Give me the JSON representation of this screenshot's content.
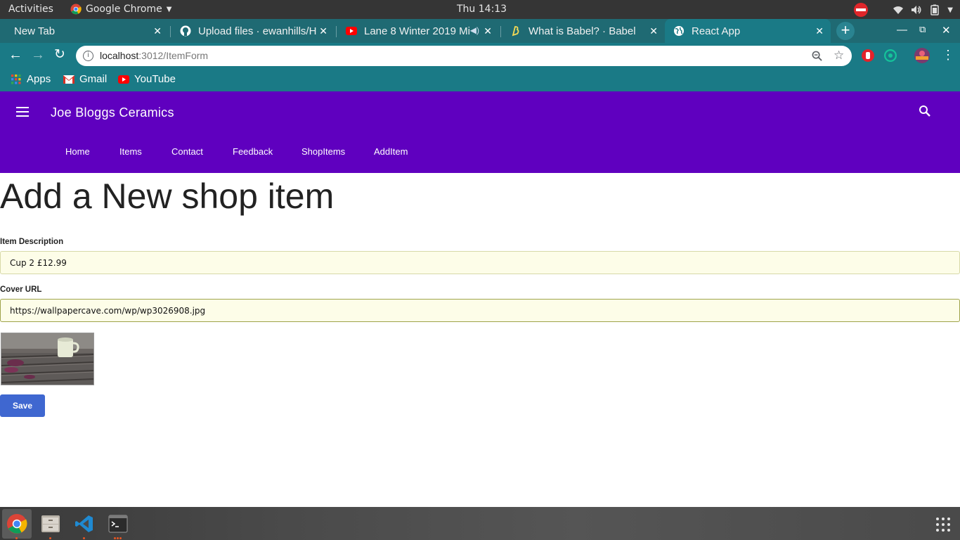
{
  "system_bar": {
    "activities": "Activities",
    "app_name": "Google Chrome",
    "clock": "Thu 14:13"
  },
  "browser": {
    "tabs": [
      {
        "label": "New Tab"
      },
      {
        "label": "Upload files · ewanhills/H"
      },
      {
        "label": "Lane 8 Winter 2019 Mi"
      },
      {
        "label": "What is Babel? · Babel"
      },
      {
        "label": "React App"
      }
    ],
    "url_host": "localhost",
    "url_rest": ":3012/ItemForm",
    "bookmarks": [
      {
        "label": "Apps"
      },
      {
        "label": "Gmail"
      },
      {
        "label": "YouTube"
      }
    ]
  },
  "app": {
    "brand": "Joe Bloggs Ceramics",
    "nav": [
      {
        "label": "Home"
      },
      {
        "label": "Items"
      },
      {
        "label": "Contact"
      },
      {
        "label": "Feedback"
      },
      {
        "label": "ShopItems"
      },
      {
        "label": "AddItem"
      }
    ],
    "colors": {
      "header": "#5f00bf",
      "save_button": "#3f67d0"
    }
  },
  "form": {
    "heading": "Add a New shop item",
    "description_label": "Item Description",
    "description_value": "Cup 2 £12.99",
    "cover_label": "Cover URL",
    "cover_value": "https://wallpapercave.com/wp/wp3026908.jpg",
    "save_label": "Save"
  }
}
